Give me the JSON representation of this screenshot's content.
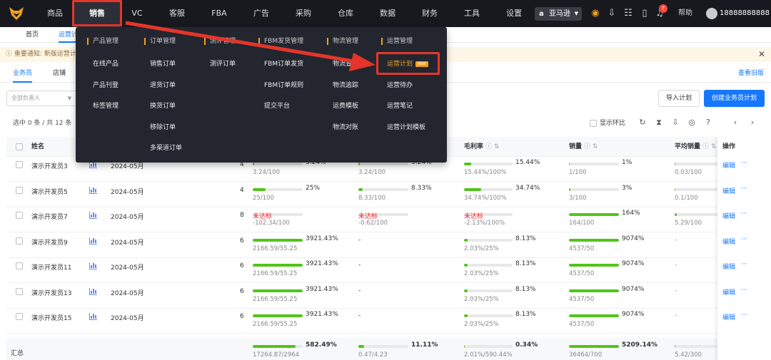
{
  "topnav": {
    "items": [
      "商品",
      "销售",
      "VC",
      "客服",
      "FBA",
      "广告",
      "采购",
      "仓库",
      "数据",
      "财务",
      "工具",
      "设置"
    ],
    "marketplace": "亚马逊",
    "marketplace_icon": "amazon-icon",
    "notification_count": "7",
    "help": "帮助",
    "user": "18888888888",
    "accent": "#f0a020",
    "highlight": "#e5352b"
  },
  "page_tabs": [
    "首页",
    "运营计"
  ],
  "notice": "重要通知: 新版运营计",
  "sub_tabs": [
    "业务员",
    "店铺"
  ],
  "view_old": "查看旧版",
  "filter": {
    "owner_placeholder": "全部负责人"
  },
  "buttons": {
    "import": "导入计划",
    "create": "创建业务员计划"
  },
  "toolbar": {
    "selection": "选中 0 条 / 共 12 条",
    "show_ratio": "显示环比"
  },
  "dropdown": {
    "columns": [
      {
        "header": "产品管理",
        "items": [
          "在线产品",
          "产品刊登",
          "标签管理"
        ]
      },
      {
        "header": "订单管理",
        "items": [
          "销售订单",
          "退货订单",
          "换货订单",
          "移除订单",
          "多渠道订单"
        ]
      },
      {
        "header": "测评管理",
        "items": [
          "测评订单"
        ]
      },
      {
        "header": "FBM发货管理",
        "items": [
          "FBM订单发货",
          "FBM订单规则",
          "提交平台"
        ]
      },
      {
        "header": "物流管理",
        "items": [
          "物流查询",
          "物流追踪",
          "运费模板",
          "物流对账"
        ]
      },
      {
        "header": "运营管理",
        "items": [
          "运营计划",
          "运营待办",
          "运营笔记",
          "运营计划模板"
        ]
      }
    ],
    "new_badge": "NEW"
  },
  "table": {
    "headers": {
      "name": "姓名",
      "margin": "毛利率",
      "sales": "销量",
      "avg_sales": "平均销量",
      "ops": "操作"
    },
    "op_edit": "编辑",
    "op_more": "···",
    "rows": [
      {
        "name": "演示开发员3",
        "month": "2024-05月",
        "num": "4",
        "c1": {
          "pct": "3.24%",
          "sub": "3.24/100",
          "fill": 0.03
        },
        "c2": {
          "pct": "3.24%",
          "sub": "3.24/100",
          "fill": 0.03
        },
        "c3": {
          "pct": "15.44%",
          "sub": "15.44%/100%",
          "fill": 0.15
        },
        "c4": {
          "pct": "1%",
          "sub": "1/100",
          "fill": 0.01
        },
        "c5": {
          "sub": "0.03/100",
          "fill": 0.01
        }
      },
      {
        "name": "演示开发员5",
        "month": "2024-05月",
        "num": "4",
        "c1": {
          "pct": "25%",
          "sub": "25/100",
          "fill": 0.25
        },
        "c2": {
          "pct": "8.33%",
          "sub": "8.33/100",
          "fill": 0.08
        },
        "c3": {
          "pct": "34.74%",
          "sub": "34.74%/100%",
          "fill": 0.35
        },
        "c4": {
          "pct": "3%",
          "sub": "3/100",
          "fill": 0.03
        },
        "c5": {
          "sub": "0.1/100",
          "fill": 0.01
        }
      },
      {
        "name": "演示开发员7",
        "month": "2024-05月",
        "num": "8",
        "c1": {
          "pct": "未达标",
          "sub": "-102.34/100",
          "fill": 0,
          "warn": true
        },
        "c2": {
          "pct": "未达标",
          "sub": "-0.62/100",
          "fill": 0,
          "warn": true
        },
        "c3": {
          "pct": "未达标",
          "sub": "-2.13%/100%",
          "fill": 0,
          "warn": true
        },
        "c4": {
          "pct": "164%",
          "sub": "164/100",
          "fill": 1
        },
        "c5": {
          "sub": "5.29/100",
          "fill": 0.05
        }
      },
      {
        "name": "演示开发员9",
        "month": "2024-05月",
        "num": "6",
        "c1": {
          "pct": "3921.43%",
          "sub": "2166.59/55.25",
          "fill": 1
        },
        "c2": {
          "pct": "-",
          "sub": "",
          "fill": -1
        },
        "c3": {
          "pct": "8.13%",
          "sub": "2.03%/25%",
          "fill": 0.08
        },
        "c4": {
          "pct": "9074%",
          "sub": "4537/50",
          "fill": 1
        },
        "c5": {
          "sub": "-",
          "fill": -1
        }
      },
      {
        "name": "演示开发员11",
        "month": "2024-05月",
        "num": "6",
        "c1": {
          "pct": "3921.43%",
          "sub": "2166.59/55.25",
          "fill": 1
        },
        "c2": {
          "pct": "-",
          "sub": "",
          "fill": -1
        },
        "c3": {
          "pct": "8.13%",
          "sub": "2.03%/25%",
          "fill": 0.08
        },
        "c4": {
          "pct": "9074%",
          "sub": "4537/50",
          "fill": 1
        },
        "c5": {
          "sub": "-",
          "fill": -1
        }
      },
      {
        "name": "演示开发员13",
        "month": "2024-05月",
        "num": "6",
        "c1": {
          "pct": "3921.43%",
          "sub": "2166.59/55.25",
          "fill": 1
        },
        "c2": {
          "pct": "-",
          "sub": "",
          "fill": -1
        },
        "c3": {
          "pct": "8.13%",
          "sub": "2.03%/25%",
          "fill": 0.08
        },
        "c4": {
          "pct": "9074%",
          "sub": "4537/50",
          "fill": 1
        },
        "c5": {
          "sub": "-",
          "fill": -1
        }
      },
      {
        "name": "演示开发员15",
        "month": "2024-05月",
        "num": "6",
        "c1": {
          "pct": "3921.43%",
          "sub": "2166.59/55.25",
          "fill": 1
        },
        "c2": {
          "pct": "-",
          "sub": "",
          "fill": -1
        },
        "c3": {
          "pct": "8.13%",
          "sub": "2.03%/25%",
          "fill": 0.08
        },
        "c4": {
          "pct": "9074%",
          "sub": "4537/50",
          "fill": 1
        },
        "c5": {
          "sub": "-",
          "fill": -1
        }
      }
    ],
    "summary": {
      "label": "汇总",
      "c1": {
        "pct": "582.49%",
        "sub": "17264.87/2964",
        "fill": 0.85
      },
      "c2": {
        "pct": "11.11%",
        "sub": "0.47/4.23",
        "fill": 0.11
      },
      "c3": {
        "pct": "0.34%",
        "sub": "2.01%/590.44%",
        "fill": 0.01
      },
      "c4": {
        "pct": "5209.14%",
        "sub": "36464/700",
        "fill": 1
      },
      "c5": {
        "sub": "5.42/300",
        "fill": 0.02
      }
    }
  }
}
